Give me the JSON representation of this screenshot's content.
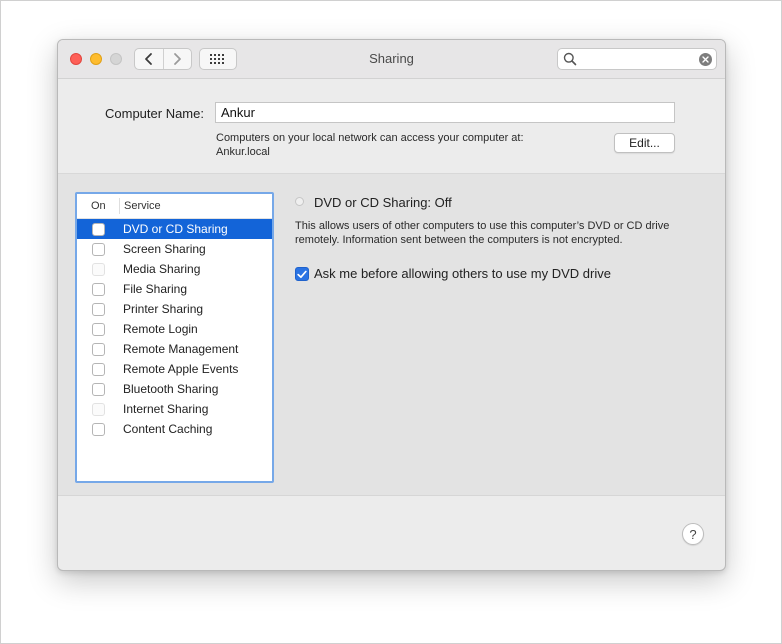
{
  "window": {
    "title": "Sharing",
    "search": {
      "value": "",
      "placeholder": ""
    }
  },
  "computer_name": {
    "label": "Computer Name:",
    "value": "Ankur",
    "description_line1": "Computers on your local network can access your computer at:",
    "description_line2": "Ankur.local",
    "edit_label": "Edit..."
  },
  "services": {
    "header_on": "On",
    "header_service": "Service",
    "items": [
      {
        "name": "DVD or CD Sharing"
      },
      {
        "name": "Screen Sharing"
      },
      {
        "name": "Media Sharing"
      },
      {
        "name": "File Sharing"
      },
      {
        "name": "Printer Sharing"
      },
      {
        "name": "Remote Login"
      },
      {
        "name": "Remote Management"
      },
      {
        "name": "Remote Apple Events"
      },
      {
        "name": "Bluetooth Sharing"
      },
      {
        "name": "Internet Sharing"
      },
      {
        "name": "Content Caching"
      }
    ]
  },
  "detail": {
    "status": "DVD or CD Sharing: Off",
    "description": "This allows users of other computers to use this computer’s DVD or CD drive remotely. Information sent between the computers is not encrypted.",
    "option_label": "Ask me before allowing others to use my DVD drive"
  },
  "help_label": "?",
  "colors": {
    "selection": "#1364d8",
    "checkbox_checked": "#2a73e3",
    "close": "#fe5f57",
    "minimize": "#febc2e"
  }
}
